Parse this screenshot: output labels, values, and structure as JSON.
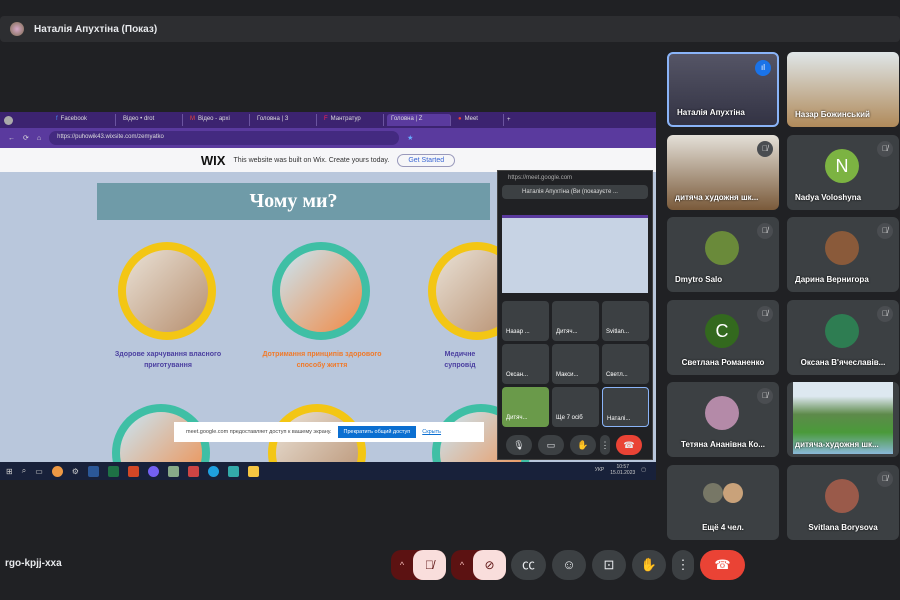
{
  "header": {
    "presenter": "Наталія Апухтіна (Показ)"
  },
  "shared_screen": {
    "tabs": [
      "Facebook",
      "Відео • drot",
      "Відео - архі",
      "Головна | З",
      "Мантратур",
      "Головна | Z",
      "Meet"
    ],
    "url": "https://puhowik43.wixsite.com/zemyatko",
    "wix": {
      "logo": "WIX",
      "text": "This website was built on Wix. Create yours today.",
      "button": "Get Started"
    },
    "heading": "Чому ми?",
    "features": [
      "Здорове харчування власного приготування",
      "Дотримання принципів здорового способу життя",
      "Медичне супровід"
    ],
    "notice": {
      "text": "meet.google.com предоставляет доступ к вашему экрану.",
      "stop": "Прекратить общий доступ",
      "hide": "Скрыть"
    },
    "tray": {
      "lang": "УКР",
      "time": "10:57",
      "date": "15.01.2023"
    },
    "mini_meet": {
      "url": "https://meet.google.com",
      "presenter": "Наталія Апухтіна (Ви (показуєте ...",
      "tiles": [
        "Назар ...",
        "Дитяч...",
        "Svitlan...",
        "Оксан...",
        "Макси...",
        "Светл...",
        "Дитяч...",
        "Ще 7 осіб",
        "Наталі..."
      ]
    }
  },
  "participants": [
    {
      "name": "Наталія Апухтіна",
      "speaking": true
    },
    {
      "name": "Назар Божинський"
    },
    {
      "name": "дитяча художня шк..."
    },
    {
      "name": "Nadya Voloshyna",
      "initial": "N"
    },
    {
      "name": "Dmytro Salo"
    },
    {
      "name": "Дарина Вернигора"
    },
    {
      "name": "Светлана Романенко",
      "initial": "C"
    },
    {
      "name": "Оксана В'ячеславів..."
    },
    {
      "name": "Тетяна Ананівна Ко..."
    },
    {
      "name": "дитяча-художня шк..."
    },
    {
      "name": "Ещё 4 чел."
    },
    {
      "name": "Svitlana Borysova"
    }
  ],
  "colors": {
    "end_call": "#ea4335",
    "muted_bg": "#f9dedc",
    "green_avatar": "#689f38"
  },
  "meeting_code": "rgo-kpjj-xxa"
}
